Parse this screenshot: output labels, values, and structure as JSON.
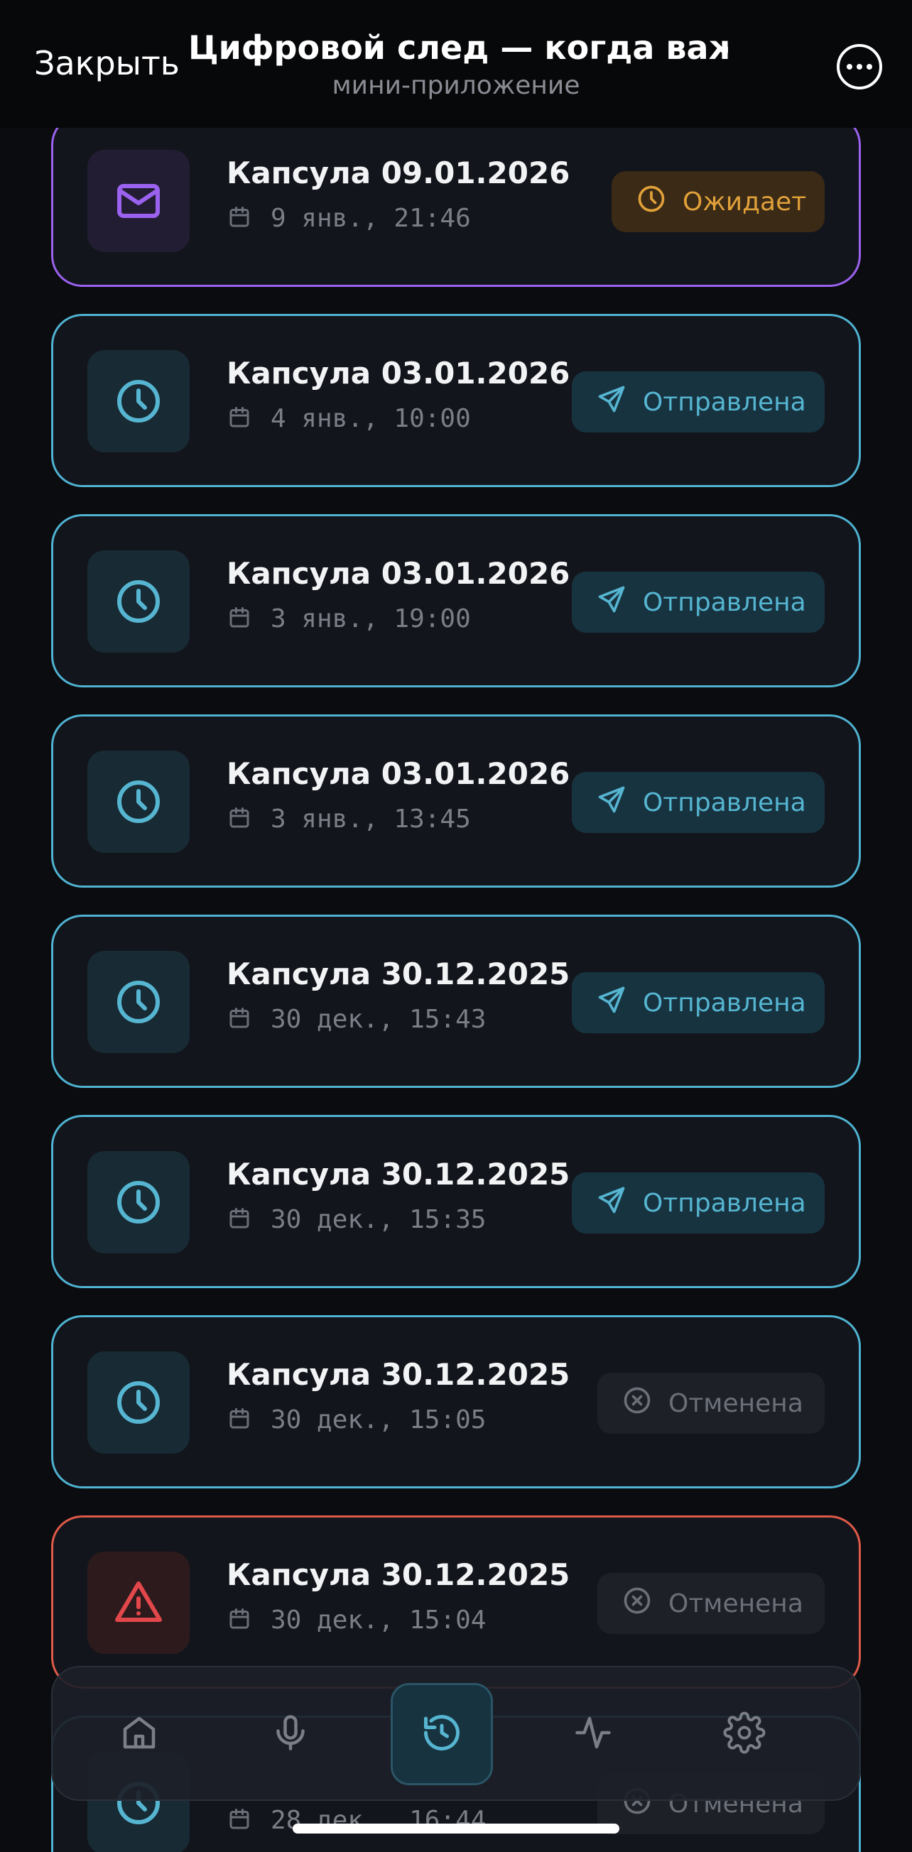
{
  "header": {
    "close_label": "Закрыть",
    "title": "Цифровой след — когда важ...",
    "subtitle": "мини-приложение",
    "more_icon": "more-horizontal-icon"
  },
  "capsules": [
    {
      "title": "Капсула 09.01.2026",
      "date": "9 янв., 21:46",
      "status": "Ожидает",
      "kind": "pending",
      "icon": "mail-icon"
    },
    {
      "title": "Капсула 03.01.2026",
      "date": "4 янв., 10:00",
      "status": "Отправлена",
      "kind": "sent",
      "icon": "clock-icon"
    },
    {
      "title": "Капсула 03.01.2026",
      "date": "3 янв., 19:00",
      "status": "Отправлена",
      "kind": "sent",
      "icon": "clock-icon"
    },
    {
      "title": "Капсула 03.01.2026",
      "date": "3 янв., 13:45",
      "status": "Отправлена",
      "kind": "sent",
      "icon": "clock-icon"
    },
    {
      "title": "Капсула 30.12.2025",
      "date": "30 дек., 15:43",
      "status": "Отправлена",
      "kind": "sent",
      "icon": "clock-icon"
    },
    {
      "title": "Капсула 30.12.2025",
      "date": "30 дек., 15:35",
      "status": "Отправлена",
      "kind": "sent",
      "icon": "clock-icon"
    },
    {
      "title": "Капсула 30.12.2025",
      "date": "30 дек., 15:05",
      "status": "Отменена",
      "kind": "cancelled",
      "icon": "clock-icon"
    },
    {
      "title": "Капсула 30.12.2025",
      "date": "30 дек., 15:04",
      "status": "Отменена",
      "kind": "cancelled-alert",
      "icon": "warning-icon"
    },
    {
      "title": "",
      "date": "28 дек., 16:44",
      "status": "Отменена",
      "kind": "cancelled",
      "icon": "clock-icon"
    }
  ],
  "tabbar": {
    "tabs": [
      {
        "icon": "home-icon",
        "active": false
      },
      {
        "icon": "microphone-icon",
        "active": false
      },
      {
        "icon": "history-icon",
        "active": true
      },
      {
        "icon": "activity-icon",
        "active": false
      },
      {
        "icon": "settings-icon",
        "active": false
      }
    ]
  },
  "colors": {
    "sent": "#56b5d1",
    "pending": "#e1a13a",
    "cancelled": "#6b6f78",
    "pending_border": "#9a62ef",
    "alert_border": "#e05a48",
    "alert_icon": "#e2474b",
    "mail_icon": "#9a62ef"
  }
}
